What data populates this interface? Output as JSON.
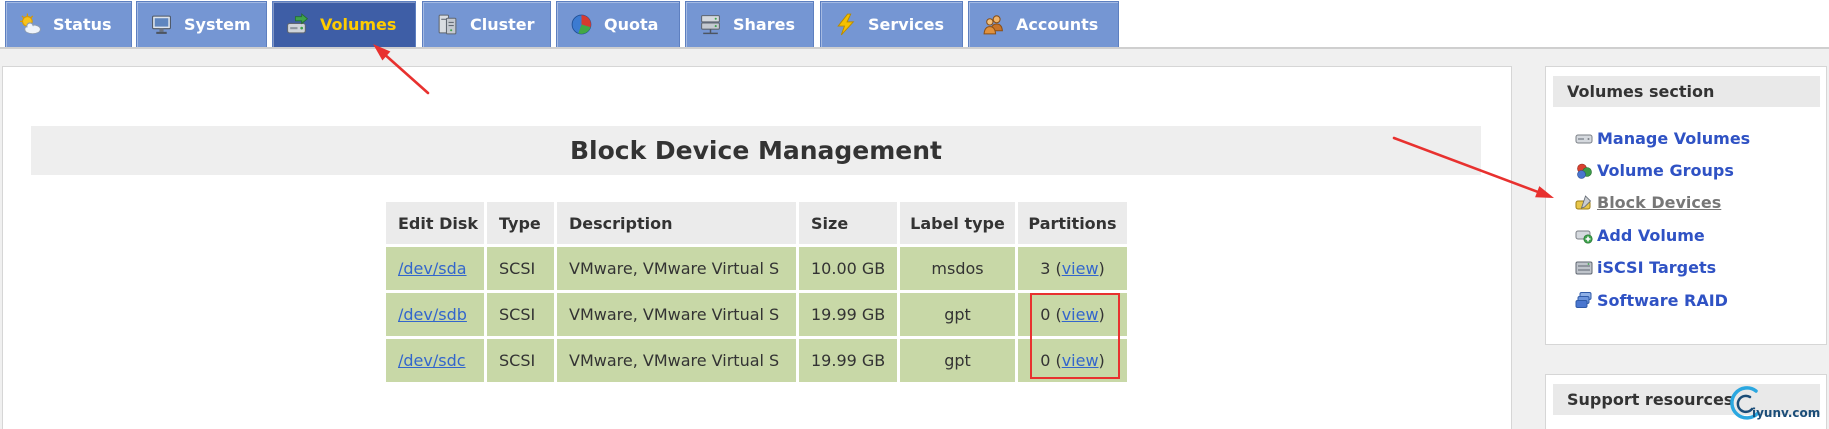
{
  "nav": {
    "tabs": [
      {
        "label": "Status",
        "icon": "weather-icon",
        "active": false
      },
      {
        "label": "System",
        "icon": "monitor-icon",
        "active": false
      },
      {
        "label": "Volumes",
        "icon": "drive-arrow-icon",
        "active": true
      },
      {
        "label": "Cluster",
        "icon": "server-icon",
        "active": false
      },
      {
        "label": "Quota",
        "icon": "pie-chart-icon",
        "active": false
      },
      {
        "label": "Shares",
        "icon": "network-drive-icon",
        "active": false
      },
      {
        "label": "Services",
        "icon": "lightning-icon",
        "active": false
      },
      {
        "label": "Accounts",
        "icon": "users-icon",
        "active": false
      }
    ]
  },
  "main": {
    "title": "Block Device Management",
    "table": {
      "headers": [
        "Edit Disk",
        "Type",
        "Description",
        "Size",
        "Label type",
        "Partitions"
      ],
      "paren_open": " (",
      "paren_close": ")",
      "rows": [
        {
          "disk": "/dev/sda",
          "type": "SCSI",
          "description": "VMware, VMware Virtual S",
          "size": "10.00 GB",
          "label_type": "msdos",
          "partitions": "3",
          "partitions_link": "view"
        },
        {
          "disk": "/dev/sdb",
          "type": "SCSI",
          "description": "VMware, VMware Virtual S",
          "size": "19.99 GB",
          "label_type": "gpt",
          "partitions": "0",
          "partitions_link": "view"
        },
        {
          "disk": "/dev/sdc",
          "type": "SCSI",
          "description": "VMware, VMware Virtual S",
          "size": "19.99 GB",
          "label_type": "gpt",
          "partitions": "0",
          "partitions_link": "view"
        }
      ]
    }
  },
  "sidebar": {
    "title": "Volumes section",
    "items": [
      {
        "label": "Manage Volumes",
        "icon": "hard-drive-icon",
        "current": false
      },
      {
        "label": "Volume Groups",
        "icon": "volume-group-icon",
        "current": false
      },
      {
        "label": "Block Devices",
        "icon": "block-device-icon",
        "current": true
      },
      {
        "label": "Add Volume",
        "icon": "add-volume-icon",
        "current": false
      },
      {
        "label": "iSCSI Targets",
        "icon": "iscsi-target-icon",
        "current": false
      },
      {
        "label": "Software RAID",
        "icon": "raid-icon",
        "current": false
      }
    ]
  },
  "support": {
    "title": "Support resources"
  },
  "watermark": {
    "chinese": "运维网",
    "domain": "iyunv.com"
  },
  "colors": {
    "tab_bg": "#7596d3",
    "tab_border": "#5d7fc0",
    "tab_text": "#ffffff",
    "tab_active_bg": "#3e5ea6",
    "tab_active_text": "#ffcc00",
    "header_bg": "#ebebeb",
    "row_bg": "#c8d8a7",
    "link": "#3366cc",
    "sidebar_link": "#2f52c4",
    "current_item": "#777777",
    "annotation": "#e8312f"
  }
}
